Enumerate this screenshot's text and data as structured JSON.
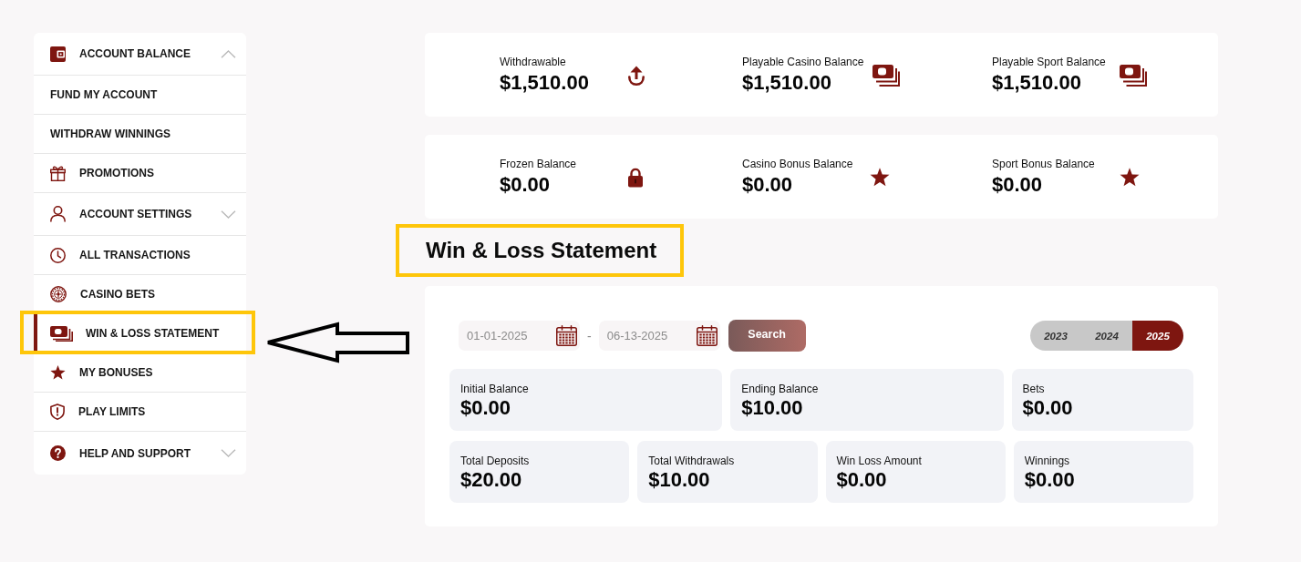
{
  "sidebar": {
    "items": [
      {
        "label": "ACCOUNT BALANCE",
        "expanded": true,
        "selected": false,
        "highlighted": false,
        "children": [
          {
            "label": "FUND MY ACCOUNT",
            "selected": false,
            "highlighted": false
          },
          {
            "label": "WITHDRAW WINNINGS",
            "selected": false,
            "highlighted": false
          }
        ]
      },
      {
        "label": "PROMOTIONS",
        "selected": false,
        "highlighted": false
      },
      {
        "label": "ACCOUNT SETTINGS",
        "expanded": false,
        "selected": false,
        "highlighted": false
      },
      {
        "label": "ALL TRANSACTIONS",
        "selected": false,
        "highlighted": false
      },
      {
        "label": "CASINO BETS",
        "selected": false,
        "highlighted": false
      },
      {
        "label": "WIN & LOSS STATEMENT",
        "selected": true,
        "highlighted": true
      },
      {
        "label": "MY BONUSES",
        "selected": false,
        "highlighted": false
      },
      {
        "label": "PLAY LIMITS",
        "selected": false,
        "highlighted": false
      },
      {
        "label": "HELP AND SUPPORT",
        "expanded": false,
        "selected": false,
        "highlighted": false
      }
    ]
  },
  "balance_panels": [
    {
      "items": [
        {
          "label": "Withdrawable",
          "amount": "$1,510.00"
        },
        {
          "label": "Playable Casino Balance",
          "amount": "$1,510.00"
        },
        {
          "label": "Playable Sport Balance",
          "amount": "$1,510.00"
        }
      ]
    },
    {
      "items": [
        {
          "label": "Frozen Balance",
          "amount": "$0.00"
        },
        {
          "label": "Casino Bonus Balance",
          "amount": "$0.00"
        },
        {
          "label": "Sport Bonus Balance",
          "amount": "$0.00"
        }
      ]
    }
  ],
  "statement": {
    "title": "Win & Loss Statement",
    "highlighted": true,
    "date_from": {
      "value": "01-01-2025"
    },
    "date_separator": "-",
    "date_to": {
      "value": "06-13-2025"
    },
    "search_button": "Search",
    "years": [
      {
        "label": "2023",
        "selected": false
      },
      {
        "label": "2024",
        "selected": false
      },
      {
        "label": "2025",
        "selected": true
      }
    ],
    "summary_rows": [
      {
        "cells": [
          {
            "label": "Initial Balance",
            "value": "$0.00"
          },
          {
            "label": "Ending Balance",
            "value": "$10.00"
          },
          {
            "label": "Bets",
            "value": "$0.00"
          }
        ]
      },
      {
        "cells": [
          {
            "label": "Total Deposits",
            "value": "$20.00"
          },
          {
            "label": "Total Withdrawals",
            "value": "$10.00"
          },
          {
            "label": "Win Loss Amount",
            "value": "$0.00"
          },
          {
            "label": "Winnings",
            "value": "$0.00"
          }
        ]
      }
    ]
  }
}
